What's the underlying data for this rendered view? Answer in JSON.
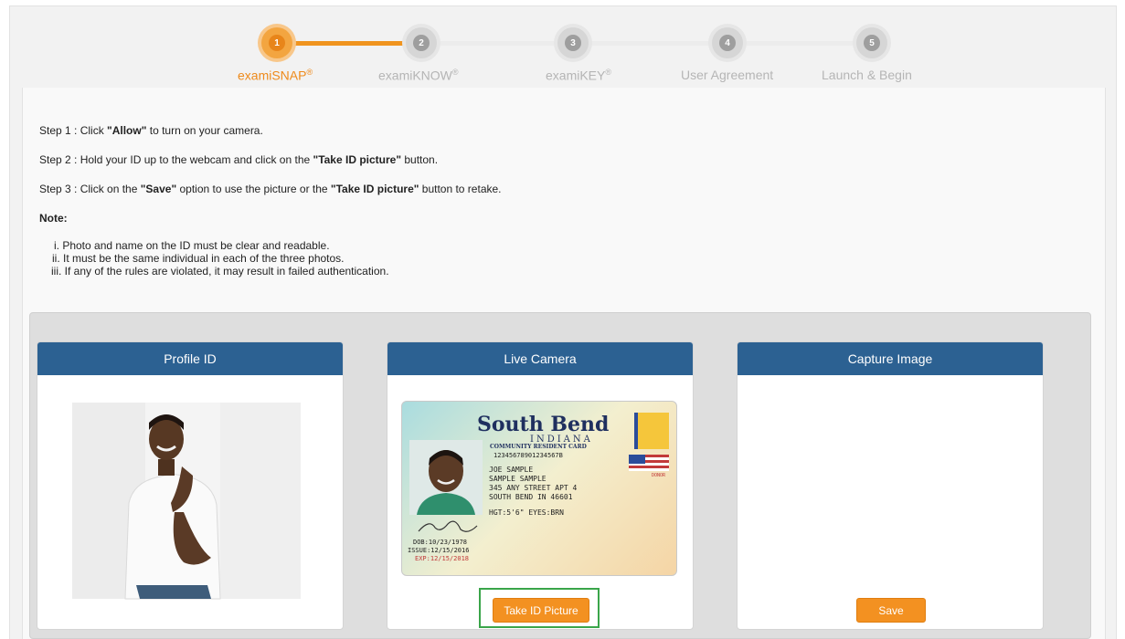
{
  "progress": {
    "steps": [
      {
        "num": "1",
        "label": "examiSNAP",
        "mark": "®",
        "active": true
      },
      {
        "num": "2",
        "label": "examiKNOW",
        "mark": "®",
        "active": false
      },
      {
        "num": "3",
        "label": "examiKEY",
        "mark": "®",
        "active": false
      },
      {
        "num": "4",
        "label": "User Agreement",
        "mark": "",
        "active": false
      },
      {
        "num": "5",
        "label": "Launch & Begin",
        "mark": "",
        "active": false
      }
    ]
  },
  "instructions": {
    "step1": {
      "pre": "Step 1 : Click ",
      "bold": "\"Allow\"",
      "post": " to turn on your camera."
    },
    "step2": {
      "pre": "Step 2 : Hold your ID up to the webcam and click on the ",
      "bold": "\"Take ID picture\"",
      "post": " button."
    },
    "step3": {
      "pre": "Step 3 : Click on the ",
      "bold1": "\"Save\"",
      "mid": " option to use the picture or the ",
      "bold2": "\"Take ID picture\"",
      "post": " button to retake."
    },
    "note_label": "Note:",
    "rules": [
      "i. Photo and name on the ID must be clear and readable.",
      "ii. It must be the same individual in each of the three photos.",
      "iii. If any of the rules are violated, it may result in failed authentication."
    ]
  },
  "cards": {
    "profile": {
      "title": "Profile ID"
    },
    "live": {
      "title": "Live Camera",
      "button": "Take ID Picture"
    },
    "capture": {
      "title": "Capture Image",
      "button": "Save"
    }
  },
  "id_card": {
    "city": "South Bend",
    "state": "INDIANA",
    "card_type": "COMMUNITY RESIDENT CARD",
    "number": "12345678901234567B",
    "name1": "JOE SAMPLE",
    "name2": "SAMPLE SAMPLE",
    "address1": "345 ANY STREET APT 4",
    "address2": "SOUTH BEND IN 46601",
    "physical": "HGT:5'6\"  EYES:BRN",
    "dob": "DOB:10/23/1978",
    "issue": "ISSUE:12/15/2016",
    "exp": "EXP:12/15/2018",
    "donor": "DONOR"
  },
  "colors": {
    "accent": "#f39121",
    "header_blue": "#2c6192",
    "highlight_green": "#3aa54a"
  }
}
